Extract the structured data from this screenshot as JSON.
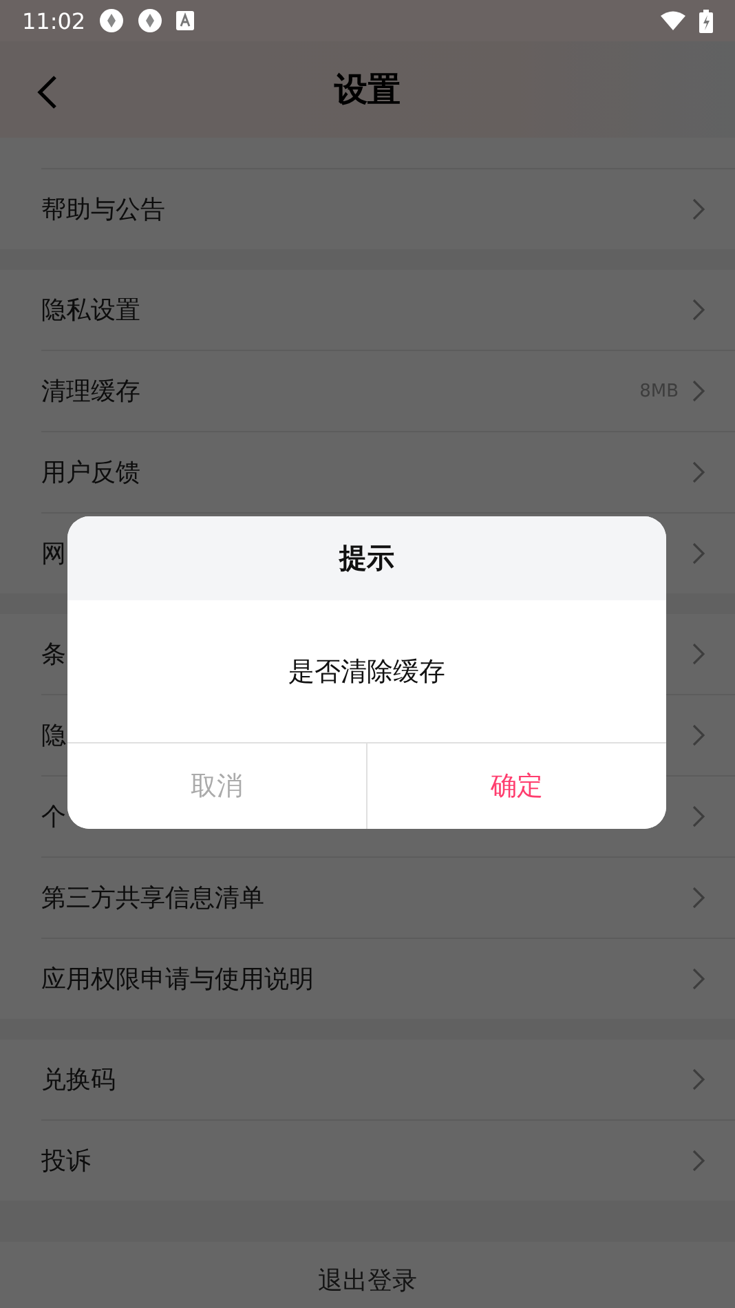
{
  "status_bar": {
    "time": "11:02"
  },
  "header": {
    "title": "设置"
  },
  "groups": [
    {
      "items": [
        {
          "label": "帮助与公告"
        }
      ]
    },
    {
      "items": [
        {
          "label": "隐私设置"
        },
        {
          "label": "清理缓存",
          "value": "8MB"
        },
        {
          "label": "用户反馈"
        },
        {
          "label": "网"
        }
      ]
    },
    {
      "items": [
        {
          "label": "条"
        },
        {
          "label": "隐"
        },
        {
          "label": "个"
        },
        {
          "label": "第三方共享信息清单"
        },
        {
          "label": "应用权限申请与使用说明"
        }
      ]
    },
    {
      "items": [
        {
          "label": "兑换码"
        },
        {
          "label": "投诉"
        }
      ]
    }
  ],
  "logout": {
    "label": "退出登录"
  },
  "dialog": {
    "title": "提示",
    "message": "是否清除缓存",
    "buttons": [
      {
        "label": "取消",
        "kind": "cancel"
      },
      {
        "label": "确定",
        "kind": "confirm"
      }
    ]
  }
}
